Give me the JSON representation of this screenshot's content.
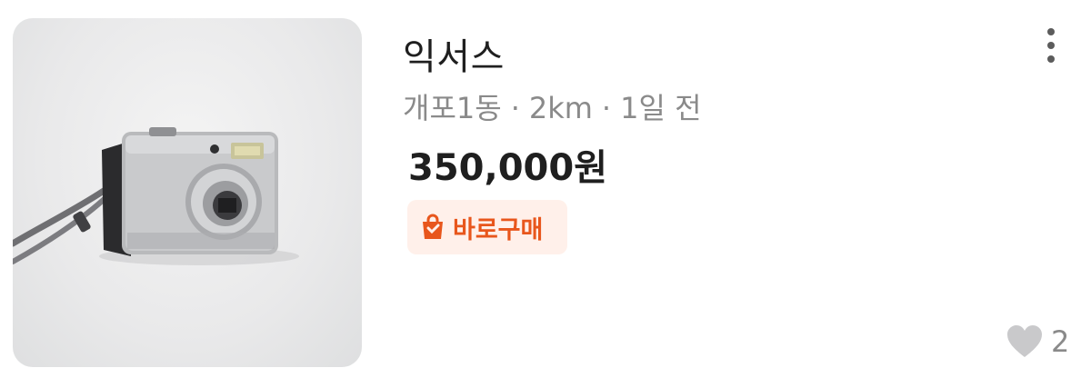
{
  "item": {
    "image_icon": "camera-photo",
    "title": "익서스",
    "location": "개포1동",
    "distance": "2km",
    "posted": "1일 전",
    "separator": "·",
    "price": "350,000원",
    "badge": {
      "label": "바로구매",
      "icon": "shopping-bag-icon",
      "color": "#e8561c",
      "background": "#fff0ea"
    },
    "likes": {
      "icon": "heart-icon",
      "count": "2"
    },
    "more_icon": "more-vertical-icon"
  }
}
